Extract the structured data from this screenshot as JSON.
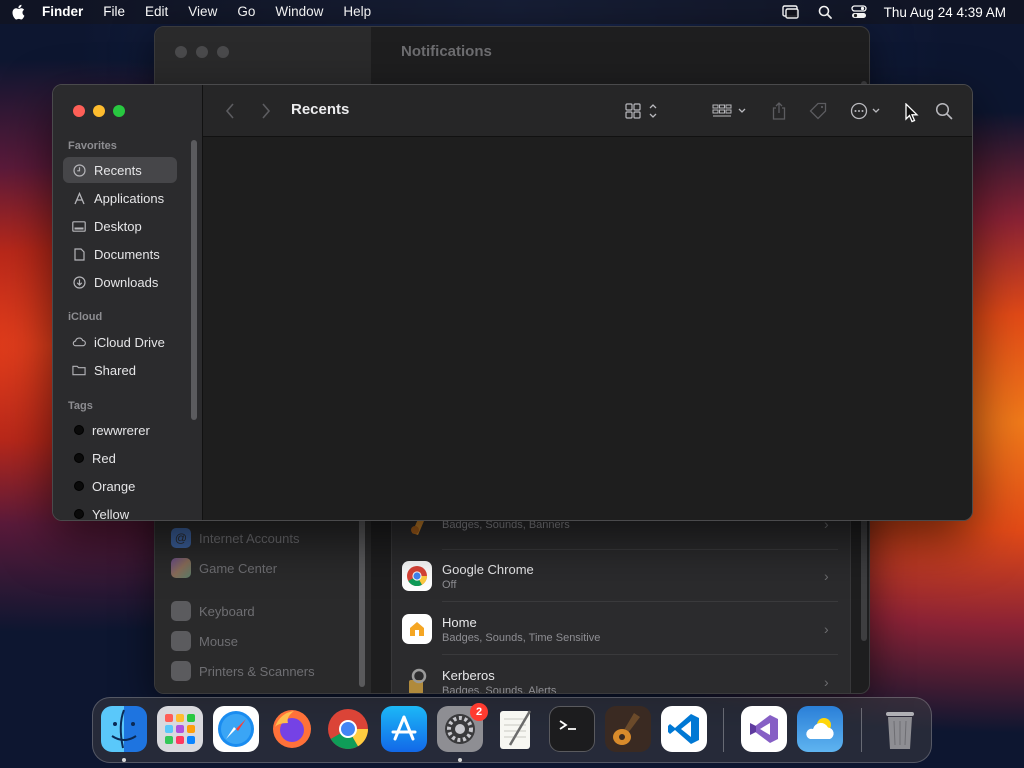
{
  "menubar": {
    "app_name": "Finder",
    "items": [
      "File",
      "Edit",
      "View",
      "Go",
      "Window",
      "Help"
    ],
    "clock": "Thu Aug 24  4:39 AM"
  },
  "settings_window": {
    "title": "Notifications",
    "sidebar_items": [
      "Internet Accounts",
      "Game Center",
      "Keyboard",
      "Mouse",
      "Printers & Scanners"
    ],
    "rows": [
      {
        "name": "",
        "sub": "Badges, Sounds, Banners"
      },
      {
        "name": "Google Chrome",
        "sub": "Off"
      },
      {
        "name": "Home",
        "sub": "Badges, Sounds, Time Sensitive"
      },
      {
        "name": "Kerberos",
        "sub": "Badges, Sounds, Alerts"
      }
    ]
  },
  "finder": {
    "title": "Recents",
    "favorites_title": "Favorites",
    "favorites": [
      "Recents",
      "Applications",
      "Desktop",
      "Documents",
      "Downloads"
    ],
    "icloud_title": "iCloud",
    "icloud": [
      "iCloud Drive",
      "Shared"
    ],
    "tags_title": "Tags",
    "tags": [
      "rewwrerer",
      "Red",
      "Orange",
      "Yellow"
    ]
  },
  "dock": {
    "apps": [
      "Finder",
      "Launchpad",
      "Safari",
      "Firefox",
      "Google Chrome",
      "App Store",
      "System Settings",
      "TextEdit",
      "Terminal",
      "GarageBand",
      "Visual Studio Code",
      "Visual Studio",
      "Weather",
      "Trash"
    ],
    "settings_badge": "2"
  },
  "colors": {
    "close": "#fe5f57",
    "minimize": "#febc2e",
    "maximize": "#28c840",
    "badge": "#ff3b30"
  }
}
